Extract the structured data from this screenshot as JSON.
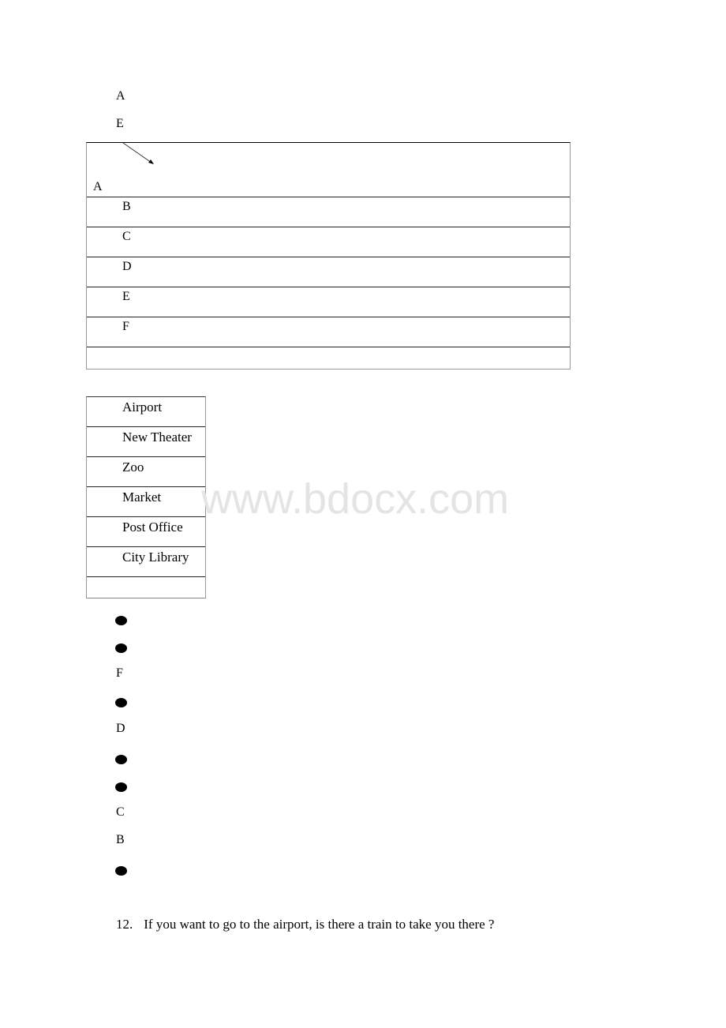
{
  "top_labels": [
    "A",
    "E"
  ],
  "grid_table": {
    "corner_label": "A",
    "rows": [
      "B",
      "C",
      "D",
      "E",
      "F",
      ""
    ]
  },
  "places_table": {
    "rows": [
      "Airport",
      "New Theater",
      "Zoo",
      "Market",
      "Post Office",
      "City Library",
      ""
    ]
  },
  "watermark": "www.bdocx.com",
  "list_items": [
    {
      "type": "bullet",
      "text": ""
    },
    {
      "type": "bullet",
      "text": ""
    },
    {
      "type": "letter",
      "text": "F"
    },
    {
      "type": "bullet",
      "text": ""
    },
    {
      "type": "letter",
      "text": "D"
    },
    {
      "type": "bullet",
      "text": ""
    },
    {
      "type": "bullet",
      "text": ""
    },
    {
      "type": "letter",
      "text": "C"
    },
    {
      "type": "letter",
      "text": "B"
    },
    {
      "type": "bullet",
      "text": ""
    }
  ],
  "question": {
    "number": "12.",
    "text": "If you want to go to the airport, is there a train to take you there ?"
  }
}
